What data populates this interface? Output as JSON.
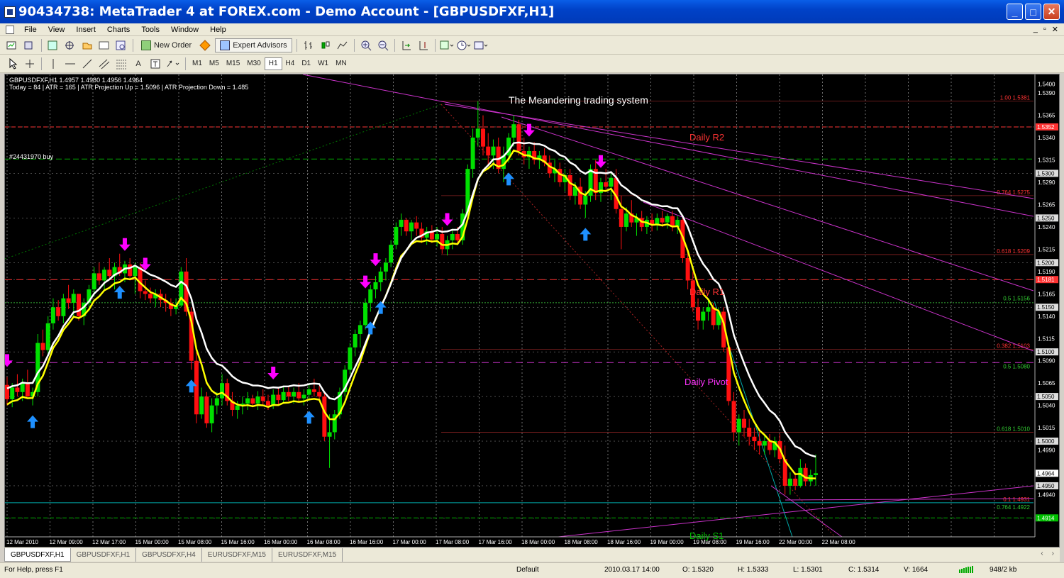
{
  "window": {
    "title": "90434738: MetaTrader 4 at FOREX.com - Demo Account - [GBPUSDFXF,H1]",
    "buttons": [
      "_",
      "□",
      "✕"
    ]
  },
  "menu": {
    "items": [
      "File",
      "View",
      "Insert",
      "Charts",
      "Tools",
      "Window",
      "Help"
    ],
    "mdi": [
      "_",
      "▫",
      "✕"
    ]
  },
  "toolbar": {
    "new_order": "New Order",
    "expert_advisors": "Expert Advisors"
  },
  "draw_tools": {
    "text_tool": "A"
  },
  "timeframes": [
    "M1",
    "M5",
    "M15",
    "M30",
    "H1",
    "H4",
    "D1",
    "W1",
    "MN"
  ],
  "active_timeframe": "H1",
  "chart": {
    "info_line1": "GBPUSDFXF,H1  1.4957 1.4980 1.4956 1.4964",
    "info_line2": "Today = 84   |   ATR = 165   |   ATR Projection Up = 1.5096   |   ATR Projection Down = 1.485",
    "system_title": "The Meandering trading system",
    "order_label": "#24431970 buy",
    "daily_labels": {
      "r2": "Daily R2",
      "r1": "Daily R1",
      "pivot": "Daily Pivot",
      "s1": "Daily S1"
    },
    "fib_labels": [
      "1.00 1.5381",
      "0.764 1.5275",
      "0.618 1.5209",
      "0.5 1.5156",
      "0.382 1.5103",
      "0.5 1.5080",
      "0.618 1.5010",
      "0.1 1.4931",
      "0.764 1.4922"
    ],
    "price_labels": [
      "1.5400",
      "1.5390",
      "1.5365",
      "1.5340",
      "1.5315",
      "1.5290",
      "1.5265",
      "1.5240",
      "1.5215",
      "1.5190",
      "1.5165",
      "1.5140",
      "1.5115",
      "1.5090",
      "1.5065",
      "1.5040",
      "1.5015",
      "1.4990",
      "1.4964",
      "1.4940",
      "1.4914"
    ],
    "highlight_prices": [
      "1.5352",
      "1.5300",
      "1.5250",
      "1.5200",
      "1.5181",
      "1.5150",
      "1.5100",
      "1.5050",
      "1.5000",
      "1.4950",
      "1.4914"
    ],
    "time_labels": [
      "12 Mar 2010",
      "12 Mar 09:00",
      "12 Mar 17:00",
      "15 Mar 00:00",
      "15 Mar 08:00",
      "15 Mar 16:00",
      "16 Mar 00:00",
      "16 Mar 08:00",
      "16 Mar 16:00",
      "17 Mar 00:00",
      "17 Mar 08:00",
      "17 Mar 16:00",
      "18 Mar 00:00",
      "18 Mar 08:00",
      "18 Mar 16:00",
      "19 Mar 00:00",
      "19 Mar 08:00",
      "19 Mar 16:00",
      "22 Mar 00:00",
      "22 Mar 08:00"
    ],
    "current_price": "1.4964",
    "ohlc": [
      [
        1.5063,
        1.5072,
        1.504,
        1.5047
      ],
      [
        1.5047,
        1.5065,
        1.5038,
        1.506
      ],
      [
        1.506,
        1.5075,
        1.505,
        1.5055
      ],
      [
        1.5055,
        1.507,
        1.5045,
        1.5065
      ],
      [
        1.5065,
        1.508,
        1.5058,
        1.505
      ],
      [
        1.505,
        1.506,
        1.504,
        1.5055
      ],
      [
        1.5055,
        1.512,
        1.505,
        1.511
      ],
      [
        1.511,
        1.5125,
        1.5095,
        1.5102
      ],
      [
        1.5102,
        1.514,
        1.5098,
        1.5132
      ],
      [
        1.5132,
        1.516,
        1.5125,
        1.515
      ],
      [
        1.515,
        1.5158,
        1.5135,
        1.514
      ],
      [
        1.514,
        1.5165,
        1.5132,
        1.516
      ],
      [
        1.516,
        1.5175,
        1.5148,
        1.5155
      ],
      [
        1.5155,
        1.517,
        1.514,
        1.5165
      ],
      [
        1.5165,
        1.5162,
        1.5135,
        1.514
      ],
      [
        1.514,
        1.516,
        1.513,
        1.5155
      ],
      [
        1.5155,
        1.5175,
        1.515,
        1.517
      ],
      [
        1.517,
        1.5195,
        1.5162,
        1.5188
      ],
      [
        1.5188,
        1.52,
        1.5175,
        1.518
      ],
      [
        1.518,
        1.5195,
        1.517,
        1.5192
      ],
      [
        1.5192,
        1.5205,
        1.518,
        1.5185
      ],
      [
        1.5185,
        1.52,
        1.517,
        1.5195
      ],
      [
        1.5195,
        1.521,
        1.5185,
        1.5188
      ],
      [
        1.5188,
        1.5202,
        1.5178,
        1.5198
      ],
      [
        1.5198,
        1.5205,
        1.518,
        1.5185
      ],
      [
        1.5185,
        1.52,
        1.5165,
        1.5195
      ],
      [
        1.5195,
        1.52,
        1.516,
        1.5168
      ],
      [
        1.5168,
        1.518,
        1.5158,
        1.5165
      ],
      [
        1.5165,
        1.5172,
        1.5155,
        1.516
      ],
      [
        1.516,
        1.517,
        1.515,
        1.5165
      ],
      [
        1.5165,
        1.517,
        1.515,
        1.5158
      ],
      [
        1.5158,
        1.5165,
        1.5145,
        1.5155
      ],
      [
        1.5155,
        1.516,
        1.514,
        1.5148
      ],
      [
        1.5148,
        1.516,
        1.5142,
        1.5152
      ],
      [
        1.5152,
        1.5195,
        1.515,
        1.519
      ],
      [
        1.519,
        1.5205,
        1.514,
        1.5145
      ],
      [
        1.5145,
        1.515,
        1.508,
        1.509
      ],
      [
        1.509,
        1.51,
        1.502,
        1.503
      ],
      [
        1.503,
        1.506,
        1.5025,
        1.505
      ],
      [
        1.505,
        1.5055,
        1.5015,
        1.502
      ],
      [
        1.502,
        1.5048,
        1.501,
        1.504
      ],
      [
        1.504,
        1.5055,
        1.503,
        1.5048
      ],
      [
        1.5048,
        1.5075,
        1.504,
        1.5065
      ],
      [
        1.5065,
        1.507,
        1.504,
        1.5045
      ],
      [
        1.5045,
        1.5055,
        1.5028,
        1.5035
      ],
      [
        1.5035,
        1.5045,
        1.5025,
        1.504
      ],
      [
        1.504,
        1.505,
        1.503,
        1.5042
      ],
      [
        1.5042,
        1.5055,
        1.5035,
        1.5048
      ],
      [
        1.5048,
        1.5052,
        1.5038,
        1.5042
      ],
      [
        1.5042,
        1.5056,
        1.5035,
        1.505
      ],
      [
        1.505,
        1.5058,
        1.504,
        1.5045
      ],
      [
        1.5045,
        1.5052,
        1.5035,
        1.504
      ],
      [
        1.504,
        1.5058,
        1.5036,
        1.5052
      ],
      [
        1.5052,
        1.506,
        1.504,
        1.5046
      ],
      [
        1.5046,
        1.5062,
        1.5042,
        1.5055
      ],
      [
        1.5055,
        1.5062,
        1.5045,
        1.505
      ],
      [
        1.505,
        1.506,
        1.5042,
        1.5055
      ],
      [
        1.5055,
        1.5065,
        1.5045,
        1.5048
      ],
      [
        1.5048,
        1.5058,
        1.504,
        1.5052
      ],
      [
        1.5052,
        1.5065,
        1.5045,
        1.5058
      ],
      [
        1.5058,
        1.507,
        1.505,
        1.5055
      ],
      [
        1.5055,
        1.5062,
        1.5045,
        1.505
      ],
      [
        1.505,
        1.5055,
        1.5,
        1.5005
      ],
      [
        1.5005,
        1.503,
        1.497,
        1.501
      ],
      [
        1.501,
        1.5035,
        1.5002,
        1.503
      ],
      [
        1.503,
        1.506,
        1.5025,
        1.5055
      ],
      [
        1.5055,
        1.5085,
        1.505,
        1.508
      ],
      [
        1.508,
        1.511,
        1.5075,
        1.5105
      ],
      [
        1.5105,
        1.5125,
        1.5095,
        1.512
      ],
      [
        1.512,
        1.5135,
        1.5105,
        1.513
      ],
      [
        1.513,
        1.516,
        1.5125,
        1.5155
      ],
      [
        1.5155,
        1.5175,
        1.5145,
        1.517
      ],
      [
        1.517,
        1.5185,
        1.516,
        1.5178
      ],
      [
        1.5178,
        1.5195,
        1.5168,
        1.519
      ],
      [
        1.519,
        1.5205,
        1.518,
        1.52
      ],
      [
        1.52,
        1.5225,
        1.5195,
        1.522
      ],
      [
        1.522,
        1.5245,
        1.5215,
        1.524
      ],
      [
        1.524,
        1.5255,
        1.523,
        1.5248
      ],
      [
        1.5248,
        1.525,
        1.523,
        1.5235
      ],
      [
        1.5235,
        1.5248,
        1.5225,
        1.5245
      ],
      [
        1.5245,
        1.5252,
        1.523,
        1.5238
      ],
      [
        1.5238,
        1.5245,
        1.5222,
        1.5228
      ],
      [
        1.5228,
        1.524,
        1.522,
        1.5235
      ],
      [
        1.5235,
        1.5242,
        1.5222,
        1.5226
      ],
      [
        1.5226,
        1.524,
        1.5218,
        1.5232
      ],
      [
        1.5232,
        1.524,
        1.521,
        1.5215
      ],
      [
        1.5215,
        1.523,
        1.5208,
        1.5225
      ],
      [
        1.5225,
        1.5238,
        1.5215,
        1.5232
      ],
      [
        1.5232,
        1.524,
        1.522,
        1.5225
      ],
      [
        1.5225,
        1.526,
        1.522,
        1.5255
      ],
      [
        1.5255,
        1.531,
        1.525,
        1.5305
      ],
      [
        1.5305,
        1.535,
        1.5295,
        1.534
      ],
      [
        1.534,
        1.5381,
        1.533,
        1.535
      ],
      [
        1.535,
        1.5365,
        1.532,
        1.533
      ],
      [
        1.533,
        1.5345,
        1.531,
        1.532
      ],
      [
        1.532,
        1.5338,
        1.5305,
        1.533
      ],
      [
        1.533,
        1.534,
        1.53,
        1.5305
      ],
      [
        1.5305,
        1.533,
        1.529,
        1.532
      ],
      [
        1.532,
        1.5345,
        1.5312,
        1.534
      ],
      [
        1.534,
        1.5365,
        1.533,
        1.5355
      ],
      [
        1.5355,
        1.536,
        1.532,
        1.5325
      ],
      [
        1.5325,
        1.534,
        1.531,
        1.5318
      ],
      [
        1.5318,
        1.533,
        1.5305,
        1.5325
      ],
      [
        1.5325,
        1.5335,
        1.531,
        1.5315
      ],
      [
        1.5315,
        1.5325,
        1.5305,
        1.532
      ],
      [
        1.532,
        1.5328,
        1.5308,
        1.5312
      ],
      [
        1.5312,
        1.532,
        1.5295,
        1.53
      ],
      [
        1.53,
        1.5315,
        1.529,
        1.5305
      ],
      [
        1.5305,
        1.5312,
        1.5285,
        1.529
      ],
      [
        1.529,
        1.5305,
        1.528,
        1.5298
      ],
      [
        1.5298,
        1.5305,
        1.527,
        1.5275
      ],
      [
        1.5275,
        1.529,
        1.5265,
        1.5285
      ],
      [
        1.5285,
        1.5295,
        1.526,
        1.5265
      ],
      [
        1.5265,
        1.528,
        1.525,
        1.5275
      ],
      [
        1.5275,
        1.531,
        1.5268,
        1.5305
      ],
      [
        1.5305,
        1.5315,
        1.527,
        1.5278
      ],
      [
        1.5278,
        1.5295,
        1.5268,
        1.529
      ],
      [
        1.529,
        1.5305,
        1.528,
        1.5285
      ],
      [
        1.5285,
        1.53,
        1.527,
        1.5295
      ],
      [
        1.5295,
        1.5305,
        1.5255,
        1.526
      ],
      [
        1.526,
        1.5275,
        1.5215,
        1.524
      ],
      [
        1.524,
        1.5262,
        1.5235,
        1.5255
      ],
      [
        1.5255,
        1.527,
        1.524,
        1.5245
      ],
      [
        1.5245,
        1.5255,
        1.523,
        1.525
      ],
      [
        1.525,
        1.5258,
        1.5235,
        1.524
      ],
      [
        1.524,
        1.5252,
        1.5232,
        1.5248
      ],
      [
        1.5248,
        1.5255,
        1.5235,
        1.5242
      ],
      [
        1.5242,
        1.5255,
        1.5236,
        1.525
      ],
      [
        1.525,
        1.5258,
        1.524,
        1.5245
      ],
      [
        1.5245,
        1.5255,
        1.5238,
        1.5252
      ],
      [
        1.5252,
        1.5258,
        1.5235,
        1.524
      ],
      [
        1.524,
        1.5252,
        1.5232,
        1.5248
      ],
      [
        1.5248,
        1.525,
        1.52,
        1.5205
      ],
      [
        1.5205,
        1.5215,
        1.517,
        1.518
      ],
      [
        1.518,
        1.519,
        1.5145,
        1.515
      ],
      [
        1.515,
        1.516,
        1.5125,
        1.5135
      ],
      [
        1.5135,
        1.515,
        1.5125,
        1.5145
      ],
      [
        1.5145,
        1.516,
        1.5135,
        1.515
      ],
      [
        1.515,
        1.5155,
        1.5125,
        1.513
      ],
      [
        1.513,
        1.515,
        1.5125,
        1.5145
      ],
      [
        1.5145,
        1.515,
        1.51,
        1.5105
      ],
      [
        1.5105,
        1.511,
        1.504,
        1.5045
      ],
      [
        1.5045,
        1.5055,
        1.5,
        1.501
      ],
      [
        1.501,
        1.503,
        1.4995,
        1.5025
      ],
      [
        1.5025,
        1.5035,
        1.5005,
        1.5015
      ],
      [
        1.5015,
        1.5025,
        1.4995,
        1.5005
      ],
      [
        1.5005,
        1.5015,
        1.499,
        1.5
      ],
      [
        1.5,
        1.501,
        1.4985,
        1.4995
      ],
      [
        1.4995,
        1.5008,
        1.4985,
        1.5
      ],
      [
        1.5,
        1.5008,
        1.4985,
        1.499
      ],
      [
        1.499,
        1.5005,
        1.4982,
        1.5
      ],
      [
        1.5,
        1.5008,
        1.4975,
        1.498
      ],
      [
        1.498,
        1.4995,
        1.494,
        1.495
      ],
      [
        1.495,
        1.4965,
        1.494,
        1.4958
      ],
      [
        1.4958,
        1.4965,
        1.4945,
        1.495
      ],
      [
        1.495,
        1.498,
        1.4948,
        1.497
      ],
      [
        1.497,
        1.4975,
        1.495,
        1.4955
      ],
      [
        1.4955,
        1.4968,
        1.495,
        1.4962
      ],
      [
        1.4962,
        1.4985,
        1.495,
        1.4964
      ]
    ],
    "buy_arrows": [
      5,
      22,
      36,
      59,
      71,
      73,
      98,
      113
    ],
    "sell_arrows": [
      0,
      23,
      27,
      52,
      70,
      72,
      86,
      102,
      116
    ]
  },
  "tabs": [
    "GBPUSDFXF,H1",
    "GBPUSDFXF,H1",
    "GBPUSDFXF,H4",
    "EURUSDFXF,M15",
    "EURUSDFXF,M15"
  ],
  "tab_scroll": [
    "‹",
    "›"
  ],
  "status": {
    "help": "For Help, press F1",
    "profile": "Default",
    "datetime": "2010.03.17 14:00",
    "open": "O: 1.5320",
    "high": "H: 1.5333",
    "low": "L: 1.5301",
    "close": "C: 1.5314",
    "volume": "V: 1664",
    "traffic": "948/2 kb"
  },
  "colors": {
    "bull": "#00e000",
    "bear": "#ff1010",
    "ma_fast": "#ffff00",
    "ma_slow": "#ffffff",
    "buy_arrow": "#1e90ff",
    "sell_arrow": "#ff00ff",
    "pivot": "#cc33cc",
    "resistance": "#ff3333"
  }
}
